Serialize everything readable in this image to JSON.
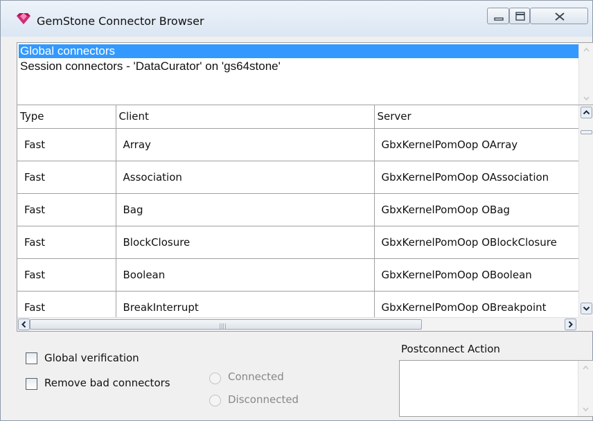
{
  "window": {
    "title": "GemStone Connector Browser",
    "icon": "gem-icon"
  },
  "categories": {
    "items": [
      {
        "label": "Global connectors",
        "selected": true
      },
      {
        "label": "Session connectors - 'DataCurator' on 'gs64stone'",
        "selected": false
      }
    ]
  },
  "table": {
    "columns": [
      "Type",
      "Client",
      "Server"
    ],
    "rows": [
      {
        "type": "Fast",
        "client": "Array",
        "server": "GbxKernelPomOop OArray"
      },
      {
        "type": "Fast",
        "client": "Association",
        "server": "GbxKernelPomOop OAssociation"
      },
      {
        "type": "Fast",
        "client": "Bag",
        "server": "GbxKernelPomOop OBag"
      },
      {
        "type": "Fast",
        "client": "BlockClosure",
        "server": "GbxKernelPomOop OBlockClosure"
      },
      {
        "type": "Fast",
        "client": "Boolean",
        "server": "GbxKernelPomOop OBoolean"
      },
      {
        "type": "Fast",
        "client": "BreakInterrupt",
        "server": "GbxKernelPomOop OBreakpoint"
      }
    ]
  },
  "options": {
    "global_verification": {
      "label": "Global verification",
      "checked": false
    },
    "remove_bad_connectors": {
      "label": "Remove bad connectors",
      "checked": false
    }
  },
  "status_filter": {
    "connected": {
      "label": "Connected",
      "enabled": false
    },
    "disconnected": {
      "label": "Disconnected",
      "enabled": false
    }
  },
  "postconnect": {
    "label": "Postconnect Action",
    "value": ""
  },
  "colors": {
    "selection": "#3399ff",
    "border": "#a0a0a0",
    "window_bg": "#f0f0f0",
    "disabled_text": "#888888"
  }
}
